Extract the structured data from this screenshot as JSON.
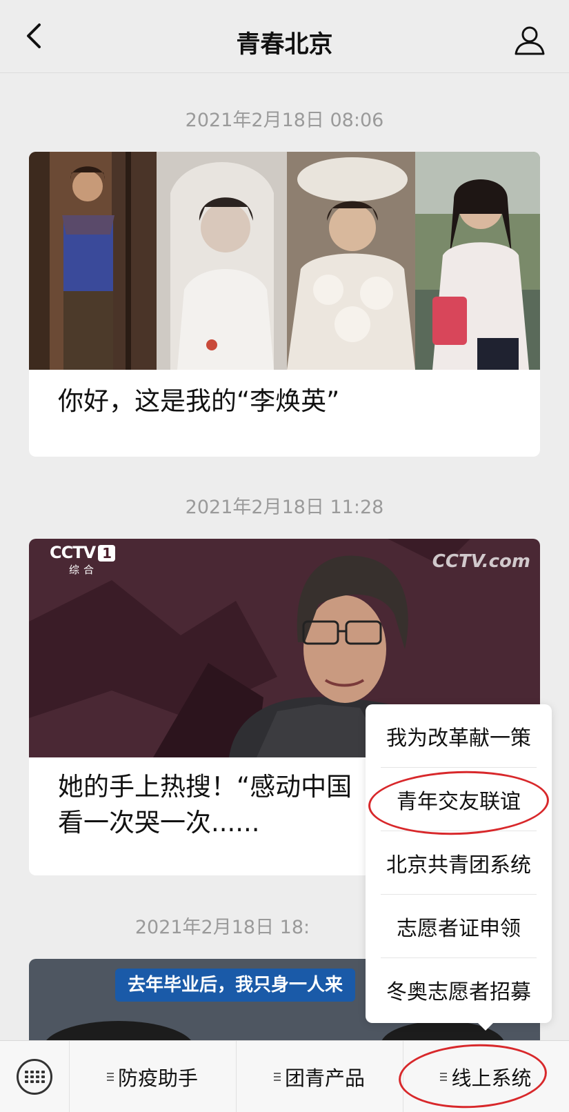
{
  "header": {
    "title": "青春北京"
  },
  "feed": [
    {
      "timestamp": "2021年2月18日 08:06",
      "title": "你好，这是我的“李焕英”"
    },
    {
      "timestamp": "2021年2月18日 11:28",
      "title_line1": "她的手上热搜！“感动中国",
      "title_line2": "看一次哭一次......",
      "logo_channel": "CCTV",
      "logo_channel_num": "1",
      "logo_channel_sub": "综合",
      "logo_site": "CCTV.com"
    },
    {
      "timestamp": "2021年2月18日 18:",
      "banner_text": "去年毕业后，我只身一人来"
    }
  ],
  "popup_menu": {
    "items": [
      "我为改革献一策",
      "青年交友联谊",
      "北京共青团系统",
      "志愿者证申领",
      "冬奥志愿者招募"
    ]
  },
  "bottom_menu": {
    "tabs": [
      "防疫助手",
      "团青产品",
      "线上系统"
    ]
  },
  "annotation_color": "#d8282b"
}
